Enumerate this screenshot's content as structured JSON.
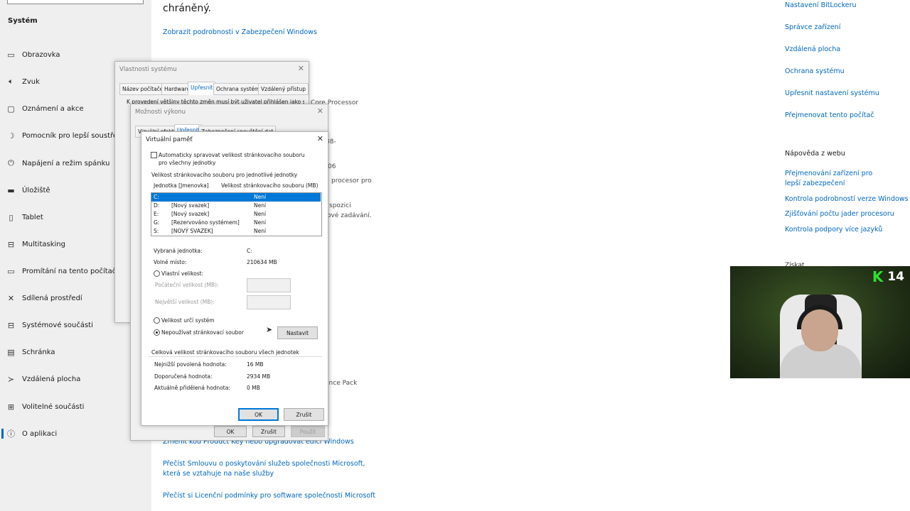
{
  "sidebar": {
    "section_title": "Systém",
    "items": [
      {
        "icon": "monitor-icon",
        "glyph": "▭",
        "label": "Obrazovka"
      },
      {
        "icon": "speaker-icon",
        "glyph": "🔈︎",
        "label": "Zvuk"
      },
      {
        "icon": "notification-icon",
        "glyph": "▢",
        "label": "Oznámení a akce"
      },
      {
        "icon": "moon-icon",
        "glyph": "☽",
        "label": "Pomocník pro lepší soustředění"
      },
      {
        "icon": "power-icon",
        "glyph": "⏻",
        "label": "Napájení a režim spánku"
      },
      {
        "icon": "storage-icon",
        "glyph": "▬",
        "label": "Úložiště"
      },
      {
        "icon": "tablet-icon",
        "glyph": "▯",
        "label": "Tablet"
      },
      {
        "icon": "multitasking-icon",
        "glyph": "⊟",
        "label": "Multitasking"
      },
      {
        "icon": "projection-icon",
        "glyph": "▭",
        "label": "Promítání na tento počítač"
      },
      {
        "icon": "share-icon",
        "glyph": "✕",
        "label": "Sdílená prostředí"
      },
      {
        "icon": "components-icon",
        "glyph": "⊟",
        "label": "Systémové součásti"
      },
      {
        "icon": "clipboard-icon",
        "glyph": "▤",
        "label": "Schránka"
      },
      {
        "icon": "remote-icon",
        "glyph": "≻",
        "label": "Vzdálená plocha"
      },
      {
        "icon": "optional-features-icon",
        "glyph": "⊞",
        "label": "Volitelné součásti"
      },
      {
        "icon": "info-icon",
        "glyph": "ⓘ",
        "label": "O aplikaci"
      }
    ]
  },
  "main": {
    "heading_fragment": "chráněný.",
    "security_link": "Zobrazit podrobnosti v Zabezpečení Windows",
    "fragments": [
      "Core Processor",
      "38-",
      "06",
      "procesor pro",
      "spozici",
      "ové zadávání.",
      "ence Pack"
    ],
    "bottom_links": [
      "Změnit kód Product Key nebo upgradovat edici Windows",
      "Přečíst Smlouvu o poskytování služeb společnosti Microsoft, která se vztahuje na naše služby",
      "Přečíst si Licenční podmínky pro software společnosti Microsoft"
    ]
  },
  "right_panel": {
    "links": [
      "Nastavení BitLockeru",
      "Správce zařízení",
      "Vzdálená plocha",
      "Ochrana systému",
      "Upřesnit nastavení systému",
      "Přejmenovat tento počítač"
    ],
    "web_help_title": "Nápověda z webu",
    "web_help_links": [
      "Přejmenování zařízení pro lepší zabezpečení",
      "Kontrola podrobností verze Windows",
      "Zjišťování počtu jader procesoru",
      "Kontrola podpory více jazyků"
    ],
    "partial_text": "Získat..."
  },
  "system_properties": {
    "title": "Vlastnosti systému",
    "tabs": [
      "Název počítače",
      "Hardware",
      "Upřesnit",
      "Ochrana systému",
      "Vzdálený přístup"
    ],
    "selected_tab": 2,
    "intro_text": "K provedení většiny těchto změn musí být uživatel přihlášen jako správce."
  },
  "performance_options": {
    "title": "Možnosti výkonu",
    "tabs": [
      "Vizuální efekty",
      "Upřesnit",
      "Zabezpečení spouštění dat"
    ],
    "buttons": {
      "ok": "OK",
      "cancel": "Zrušit",
      "apply": "Použít"
    }
  },
  "virtual_memory": {
    "title": "Virtuální paměť",
    "auto_manage_label": "Automaticky spravovat velikost stránkovacího souboru pro všechny jednotky",
    "auto_manage_checked": false,
    "group_title": "Velikost stránkovacího souboru pro jednotlivé jednotky",
    "col_drive": "Jednotka [Jmenovka]",
    "col_size": "Velikost stránkovacího souboru (MB)",
    "drives": [
      {
        "letter": "C:",
        "label": "",
        "size": "Není"
      },
      {
        "letter": "D:",
        "label": "[Nový svazek]",
        "size": "Není"
      },
      {
        "letter": "E:",
        "label": "[Nový svazek]",
        "size": "Není"
      },
      {
        "letter": "G:",
        "label": "[Rezervováno systémem]",
        "size": "Není"
      },
      {
        "letter": "S:",
        "label": "[NOVÝ SVAZEK]",
        "size": "Není"
      }
    ],
    "selected_drive_label": "Vybraná jednotka:",
    "selected_drive_value": "C:",
    "free_space_label": "Volné místo:",
    "free_space_value": "210634 MB",
    "custom_size_label": "Vlastní velikost:",
    "initial_size_label": "Počáteční velikost (MB):",
    "max_size_label": "Největší velikost (MB):",
    "system_managed_label": "Velikost určí systém",
    "no_paging_label": "Nepoužívat stránkovací soubor",
    "selected_option": "no_paging",
    "set_button": "Nastavit",
    "total_group_title": "Celková velikost stránkovacího souboru všech jednotek",
    "min_allowed_label": "Nejnižší povolená hodnota:",
    "min_allowed_value": "16 MB",
    "recommended_label": "Doporučená hodnota:",
    "recommended_value": "2934 MB",
    "current_label": "Aktuálně přidělená hodnota:",
    "current_value": "0 MB",
    "ok_button": "OK",
    "cancel_button": "Zrušit"
  },
  "webcam": {
    "badge_letter": "K",
    "badge_number": "14",
    "badge_color": "#2ee02e"
  },
  "colors": {
    "accent": "#0067c0",
    "selection": "#0078d7"
  }
}
